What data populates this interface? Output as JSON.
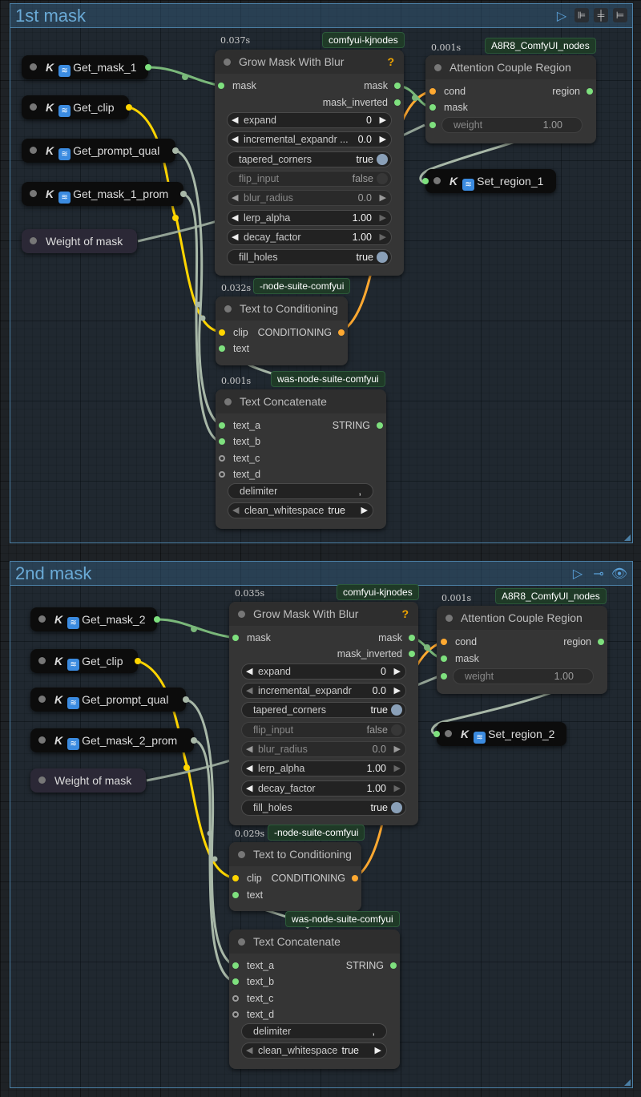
{
  "groups": [
    {
      "title": "1st mask",
      "get_nodes": [
        {
          "label": "Get_mask_1"
        },
        {
          "label": "Get_clip"
        },
        {
          "label": "Get_prompt_qual"
        },
        {
          "label": "Get_mask_1_prom"
        }
      ],
      "weight_node": {
        "label": "Weight of mask"
      },
      "grow_mask": {
        "timing": "0.037s",
        "badge": "comfyui-kjnodes",
        "title": "Grow Mask With Blur",
        "help": "?",
        "input_mask": "mask",
        "output_mask": "mask",
        "output_mask_inverted": "mask_inverted",
        "widgets": [
          {
            "label": "expand",
            "value": "0"
          },
          {
            "label": "incremental_expandr ...",
            "value": "0.0"
          },
          {
            "label": "tapered_corners",
            "value": "true"
          },
          {
            "label": "flip_input",
            "value": "false"
          },
          {
            "label": "blur_radius",
            "value": "0.0"
          },
          {
            "label": "lerp_alpha",
            "value": "1.00"
          },
          {
            "label": "decay_factor",
            "value": "1.00"
          },
          {
            "label": "fill_holes",
            "value": "true"
          }
        ]
      },
      "attention": {
        "timing": "0.001s",
        "badge": "A8R8_ComfyUI_nodes",
        "title": "Attention Couple Region",
        "input_cond": "cond",
        "input_mask": "mask",
        "output_region": "region",
        "weight_label": "weight",
        "weight_value": "1.00"
      },
      "set_node": {
        "label": "Set_region_1"
      },
      "text_cond": {
        "timing": "0.032s",
        "badge": "-node-suite-comfyui",
        "title": "Text to Conditioning",
        "input_clip": "clip",
        "input_text": "text",
        "output": "CONDITIONING"
      },
      "text_concat": {
        "timing": "0.001s",
        "badge": "was-node-suite-comfyui",
        "title": "Text Concatenate",
        "inputs": [
          "text_a",
          "text_b",
          "text_c",
          "text_d"
        ],
        "output": "STRING",
        "delimiter_label": "delimiter",
        "delimiter_value": ",",
        "clean_label": "clean_whitespace",
        "clean_value": "true"
      }
    },
    {
      "title": "2nd mask",
      "get_nodes": [
        {
          "label": "Get_mask_2"
        },
        {
          "label": "Get_clip"
        },
        {
          "label": "Get_prompt_qual"
        },
        {
          "label": "Get_mask_2_prom"
        }
      ],
      "weight_node": {
        "label": "Weight of mask"
      },
      "grow_mask": {
        "timing": "0.035s",
        "badge": "comfyui-kjnodes",
        "title": "Grow Mask With Blur",
        "help": "?",
        "input_mask": "mask",
        "output_mask": "mask",
        "output_mask_inverted": "mask_inverted",
        "widgets": [
          {
            "label": "expand",
            "value": "0"
          },
          {
            "label": "incremental_expandr",
            "value": "0.0"
          },
          {
            "label": "tapered_corners",
            "value": "true"
          },
          {
            "label": "flip_input",
            "value": "false"
          },
          {
            "label": "blur_radius",
            "value": "0.0"
          },
          {
            "label": "lerp_alpha",
            "value": "1.00"
          },
          {
            "label": "decay_factor",
            "value": "1.00"
          },
          {
            "label": "fill_holes",
            "value": "true"
          }
        ]
      },
      "attention": {
        "timing": "0.001s",
        "badge": "A8R8_ComfyUI_nodes",
        "title": "Attention Couple Region",
        "input_cond": "cond",
        "input_mask": "mask",
        "output_region": "region",
        "weight_label": "weight",
        "weight_value": "1.00"
      },
      "set_node": {
        "label": "Set_region_2"
      },
      "text_cond": {
        "timing": "0.029s",
        "badge": "-node-suite-comfyui",
        "title": "Text to Conditioning",
        "input_clip": "clip",
        "input_text": "text",
        "output": "CONDITIONING"
      },
      "text_concat": {
        "timing": "",
        "badge": "was-node-suite-comfyui",
        "title": "Text Concatenate",
        "inputs": [
          "text_a",
          "text_b",
          "text_c",
          "text_d"
        ],
        "output": "STRING",
        "delimiter_label": "delimiter",
        "delimiter_value": ",",
        "clean_label": "clean_whitespace",
        "clean_value": "true"
      }
    }
  ],
  "icons": {
    "get_node_k": "K",
    "wifi": "wifi-icon",
    "play": "play-icon",
    "bypass": "bypass-icon",
    "eye": "eye-icon",
    "align": "align-icon"
  },
  "colors": {
    "group_border": "#4b7fa5",
    "group_title": "#6aaad6",
    "wire_clip": "#ffd500",
    "wire_conditioning": "#ffa931",
    "wire_mask": "#7ab87a",
    "wire_string": "#a8b8a8",
    "badge_bg": "#1f3a27"
  }
}
